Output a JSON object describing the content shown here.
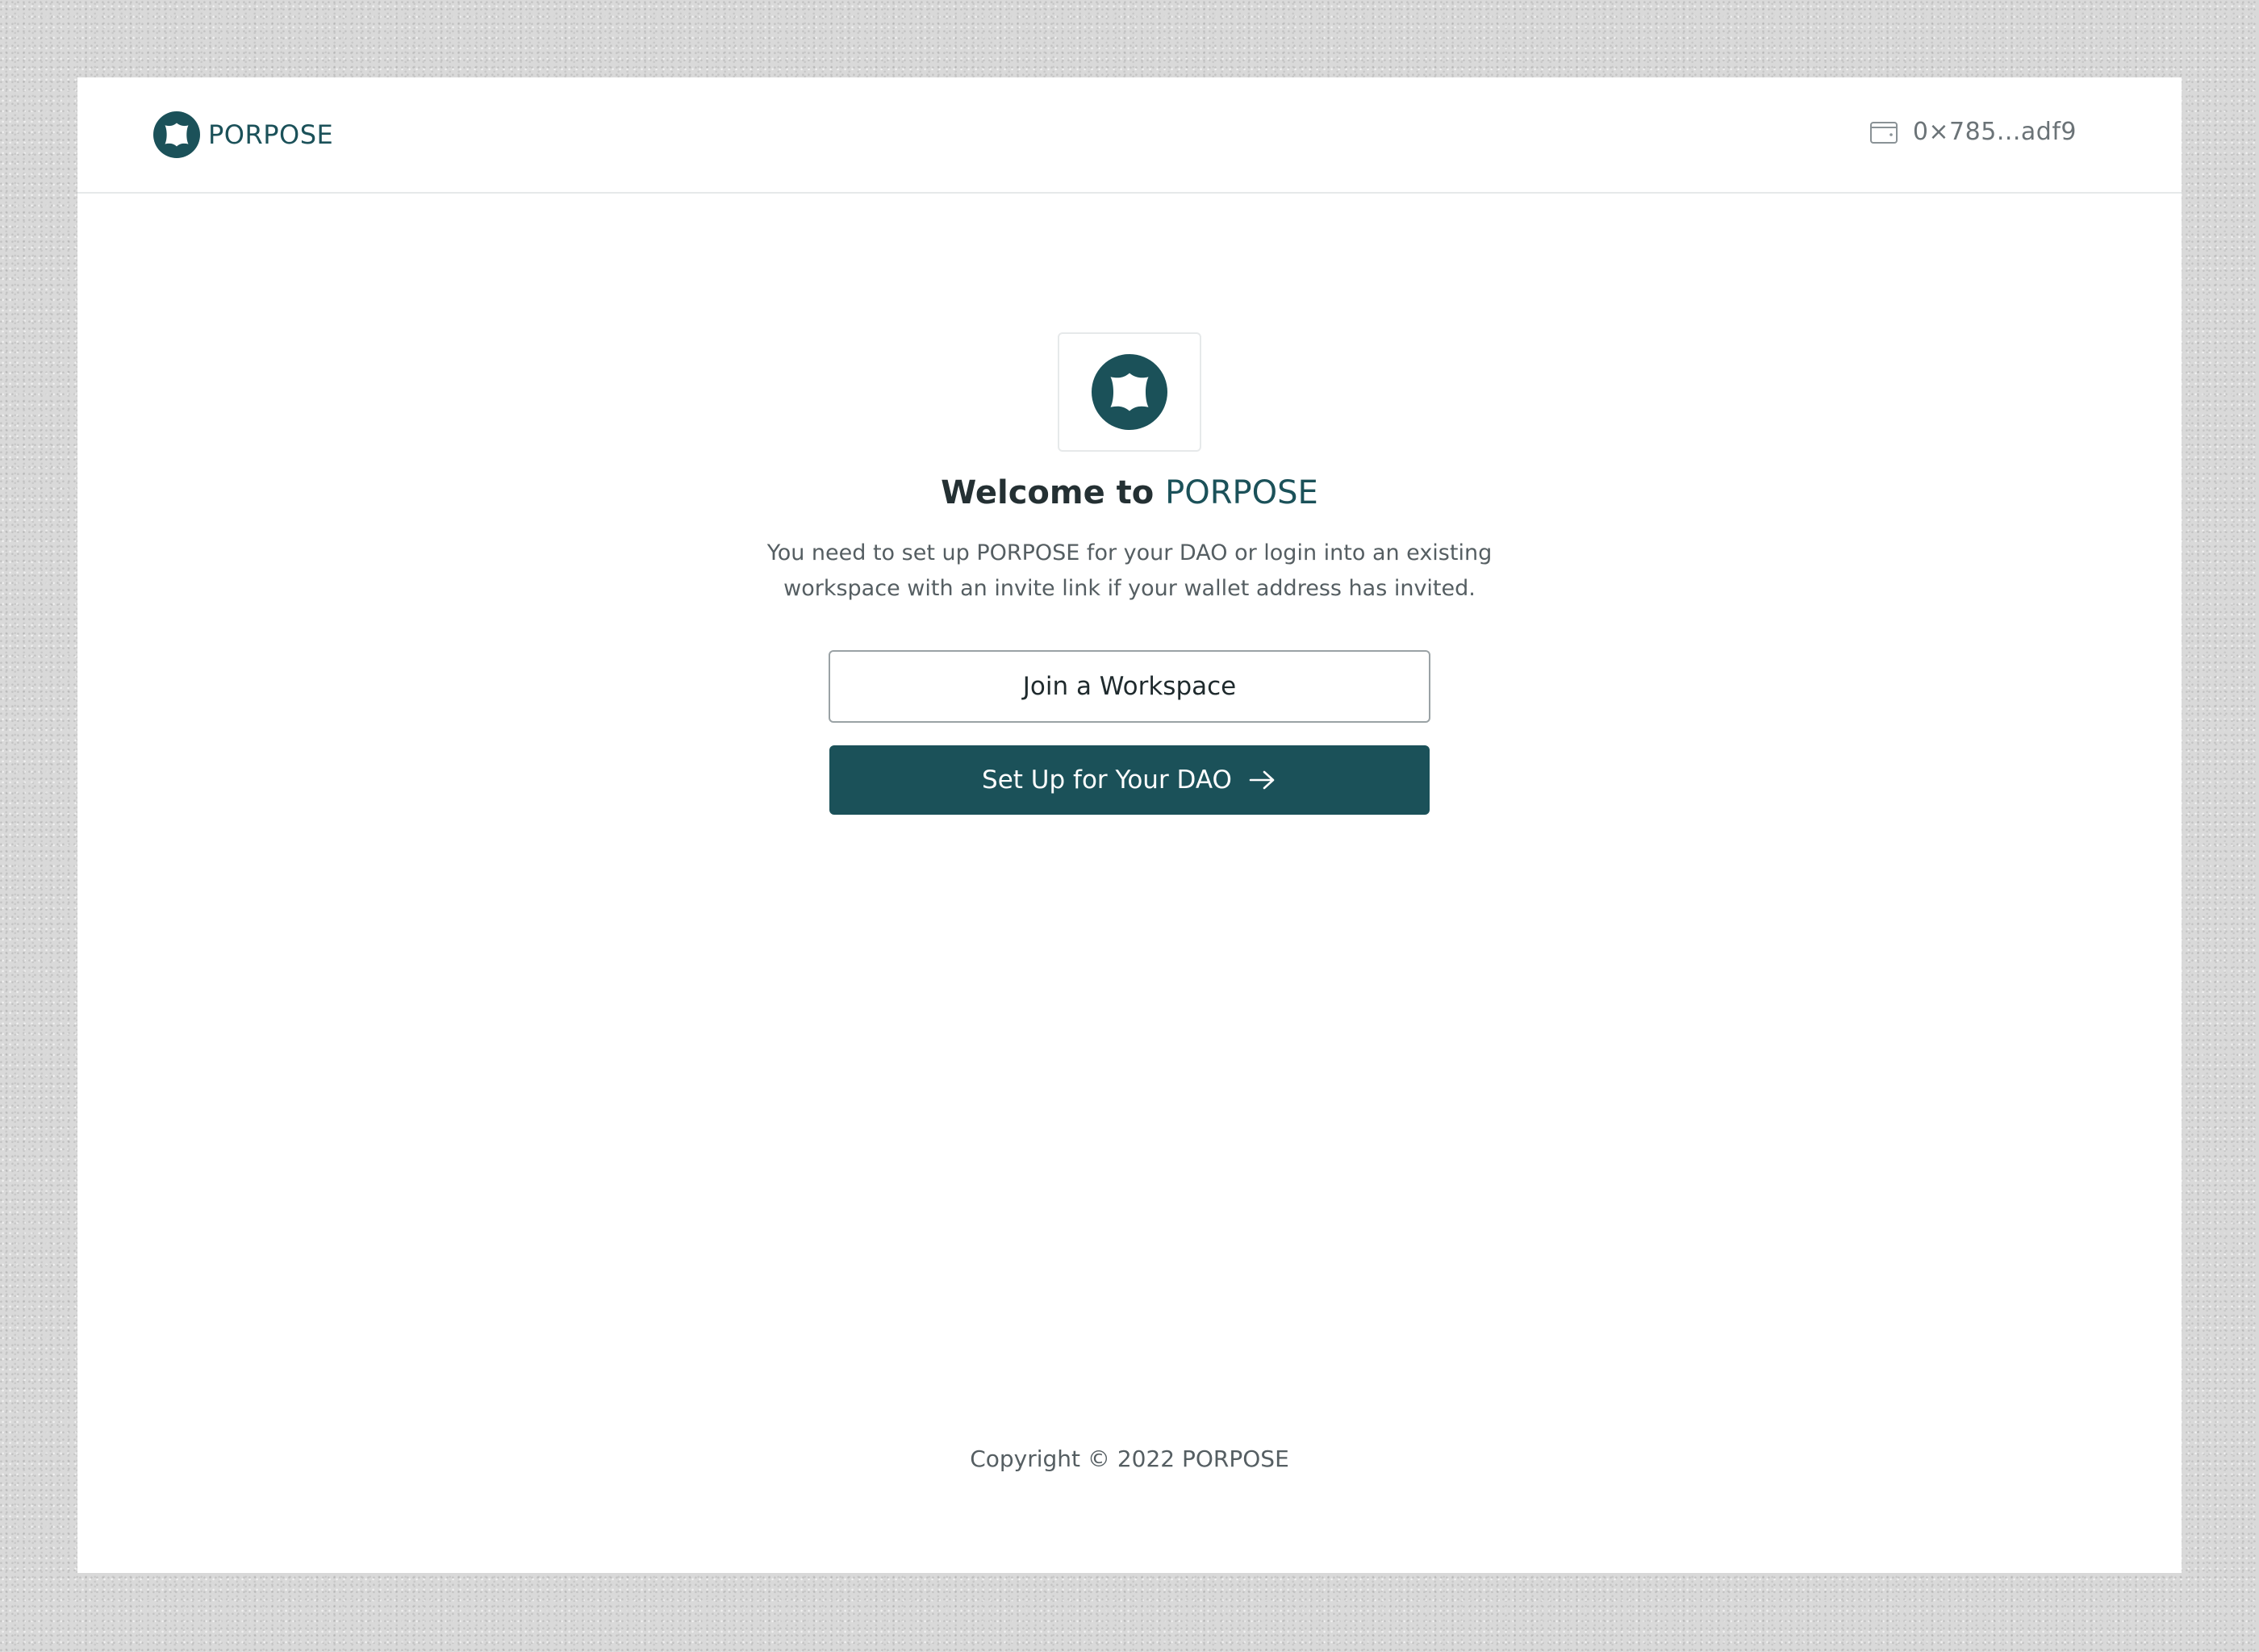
{
  "brand": {
    "name": "PORPOSE",
    "color": "#1b5159"
  },
  "header": {
    "wallet_icon": "wallet-icon",
    "wallet_address": "0×785...adf9"
  },
  "welcome": {
    "prefix": "Welcome to ",
    "brand": "PORPOSE",
    "description": "You need to set up PORPOSE for your DAO or login into an existing workspace with an invite link if your wallet address has invited."
  },
  "actions": {
    "join_label": "Join a Workspace",
    "setup_label": "Set Up for Your DAO",
    "setup_icon": "arrow-right-icon"
  },
  "footer": {
    "copyright": "Copyright © 2022 PORPOSE"
  },
  "colors": {
    "primary": "#1b5159",
    "background": "#d9d9d9",
    "surface": "#ffffff",
    "text": "#243033",
    "muted": "#555e62"
  }
}
